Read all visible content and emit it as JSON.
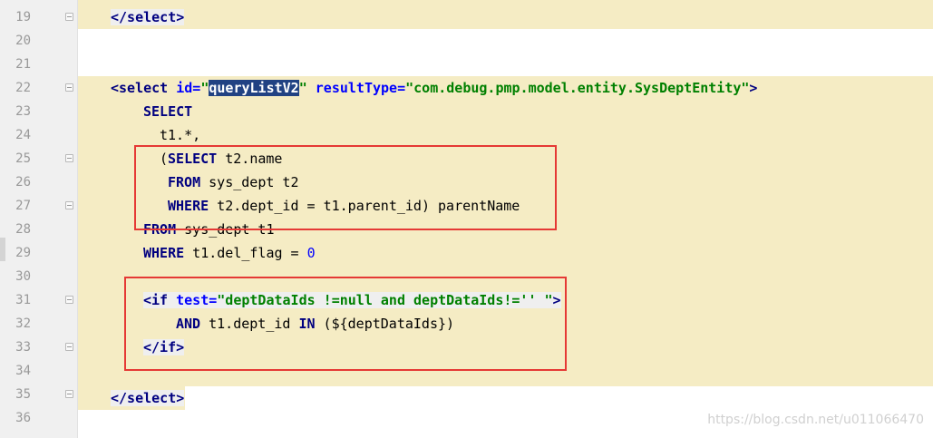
{
  "editor": {
    "line_numbers": [
      "19",
      "20",
      "21",
      "22",
      "23",
      "24",
      "25",
      "26",
      "27",
      "28",
      "29",
      "30",
      "31",
      "32",
      "33",
      "34",
      "35",
      "36"
    ],
    "lines": {
      "l19": {
        "close": "</select>"
      },
      "l22": {
        "open": "<select",
        "id_attr": " id=",
        "id_q1": "\"",
        "id_value": "queryListV2",
        "id_q2": "\"",
        "rt_attr": " resultType=",
        "rt_value": "\"com.debug.pmp.model.entity.SysDeptEntity\"",
        "gt": ">"
      },
      "l23": {
        "kw": "SELECT"
      },
      "l24": {
        "text": "t1.*,"
      },
      "l25": {
        "pre": "(",
        "kw": "SELECT",
        "rest": " t2.name"
      },
      "l26": {
        "kw": "FROM",
        "rest": " sys_dept t2"
      },
      "l27": {
        "kw": "WHERE",
        "rest": " t2.dept_id = t1.parent_id) parentName"
      },
      "l28": {
        "kw": "FROM",
        "rest": " sys_dept t1"
      },
      "l29": {
        "kw": "WHERE",
        "rest": " t1.del_flag = ",
        "num": "0"
      },
      "l31": {
        "open": "<if",
        "attr": " test=",
        "value": "\"deptDataIds !=null and deptDataIds!='' \"",
        "gt": ">"
      },
      "l32": {
        "kw1": "AND",
        "mid": " t1.dept_id ",
        "kw2": "IN",
        "rest": " (${deptDataIds})"
      },
      "l33": {
        "close": "</if>"
      },
      "l35": {
        "close": "</select>"
      }
    },
    "colors": {
      "tag": "#000080",
      "attribute": "#0000ff",
      "string": "#008000",
      "highlight": "#f5ecc4",
      "annotation_box": "#e53935"
    }
  },
  "watermark": "https://blog.csdn.net/u011066470"
}
